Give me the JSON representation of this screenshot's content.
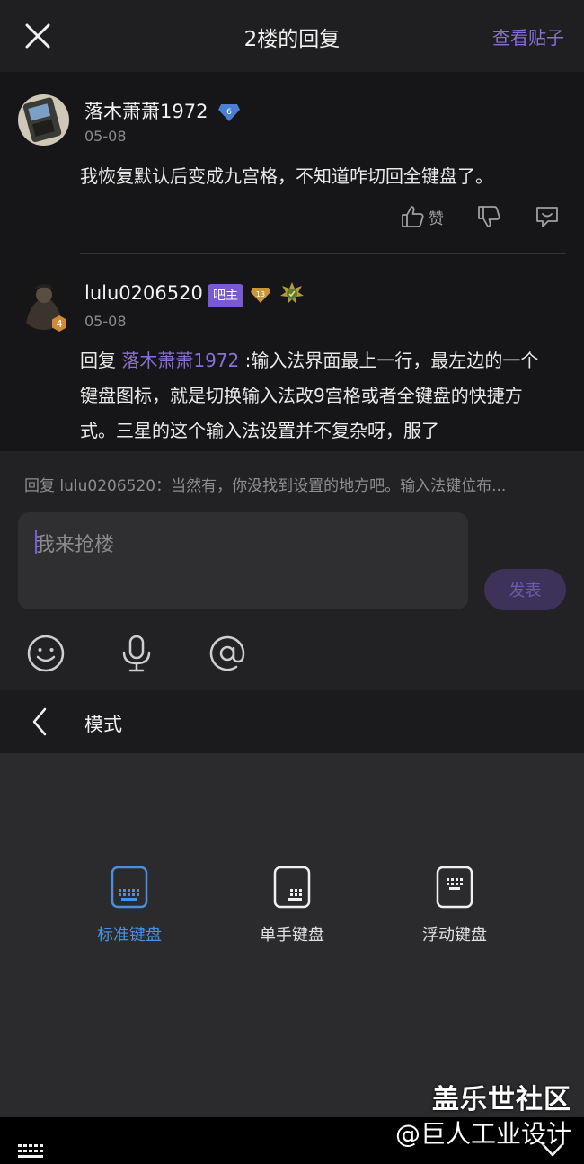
{
  "header": {
    "title": "2楼的回复",
    "view_post": "查看贴子"
  },
  "posts": [
    {
      "username": "落木萧萧1972",
      "level": "6",
      "date": "05-08",
      "content": "我恢复默认后变成九宫格，不知道咋切回全键盘了。",
      "like_label": "赞"
    },
    {
      "username": "lulu0206520",
      "avatar_level": "4",
      "admin_badge": "吧主",
      "level": "13",
      "date": "05-08",
      "reply_prefix": "回复 ",
      "mention": "落木萧萧1972",
      "content": " :输入法界面最上一行，最左边的一个键盘图标，就是切换输入法改9宫格或者全键盘的快捷方式。三星的这个输入法设置并不复杂呀，服了"
    }
  ],
  "composer": {
    "reply_to": "回复 lulu0206520：当然有，你没找到设置的地方吧。输入法键位布...",
    "placeholder": "我来抢楼",
    "send_label": "发表"
  },
  "mode_panel": {
    "title": "模式",
    "options": [
      {
        "label": "标准键盘",
        "selected": true
      },
      {
        "label": "单手键盘",
        "selected": false
      },
      {
        "label": "浮动键盘",
        "selected": false
      }
    ]
  },
  "watermark": {
    "line1": "盖乐世社区",
    "line2": "@巨人工业设计"
  },
  "colors": {
    "accent": "#8b6fd6",
    "selected_blue": "#4a8fe0",
    "background": "#161618"
  }
}
